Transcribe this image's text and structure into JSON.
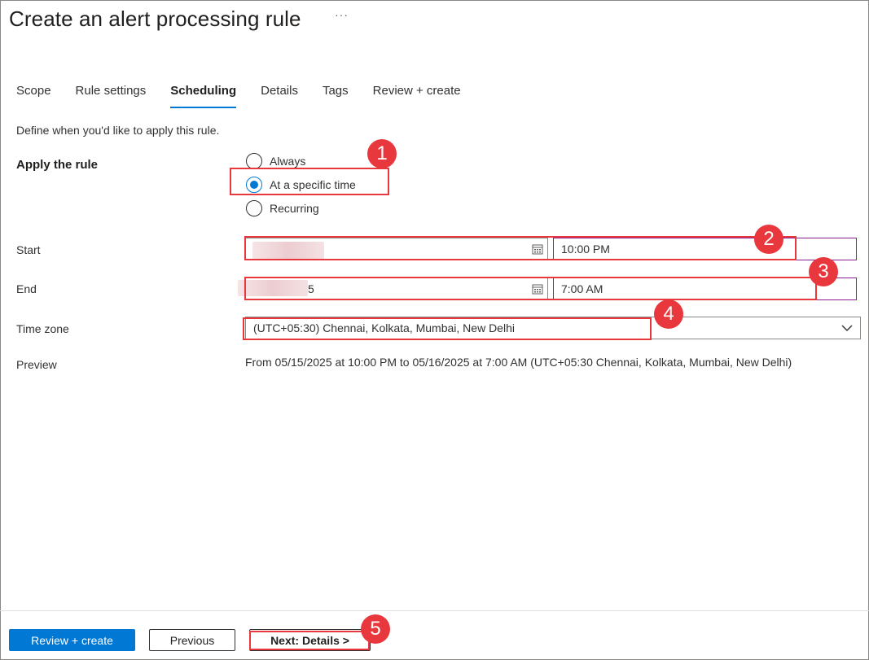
{
  "header": {
    "title": "Create an alert processing rule",
    "more_label": "···"
  },
  "tabs": [
    {
      "label": "Scope"
    },
    {
      "label": "Rule settings"
    },
    {
      "label": "Scheduling"
    },
    {
      "label": "Details"
    },
    {
      "label": "Tags"
    },
    {
      "label": "Review + create"
    }
  ],
  "active_tab": "Scheduling",
  "description": "Define when you'd like to apply this rule.",
  "apply_rule": {
    "label": "Apply the rule",
    "options": [
      {
        "label": "Always",
        "checked": false
      },
      {
        "label": "At a specific time",
        "checked": true
      },
      {
        "label": "Recurring",
        "checked": false
      }
    ]
  },
  "start": {
    "label": "Start",
    "date_value": "",
    "time_value": "10:00 PM"
  },
  "end": {
    "label": "End",
    "date_value": "5",
    "time_value": "7:00 AM"
  },
  "time_zone": {
    "label": "Time zone",
    "value": "(UTC+05:30) Chennai, Kolkata, Mumbai, New Delhi"
  },
  "preview": {
    "label": "Preview",
    "text": "From 05/15/2025 at 10:00 PM to 05/16/2025 at 7:00 AM (UTC+05:30 Chennai, Kolkata, Mumbai, New Delhi)"
  },
  "footer": {
    "review_create": "Review + create",
    "previous": "Previous",
    "next": "Next: Details >"
  },
  "annotations": [
    "1",
    "2",
    "3",
    "4",
    "5"
  ],
  "colors": {
    "accent": "#0078d4",
    "annotation": "#e8383d",
    "time_border": "#8b1b8f"
  }
}
